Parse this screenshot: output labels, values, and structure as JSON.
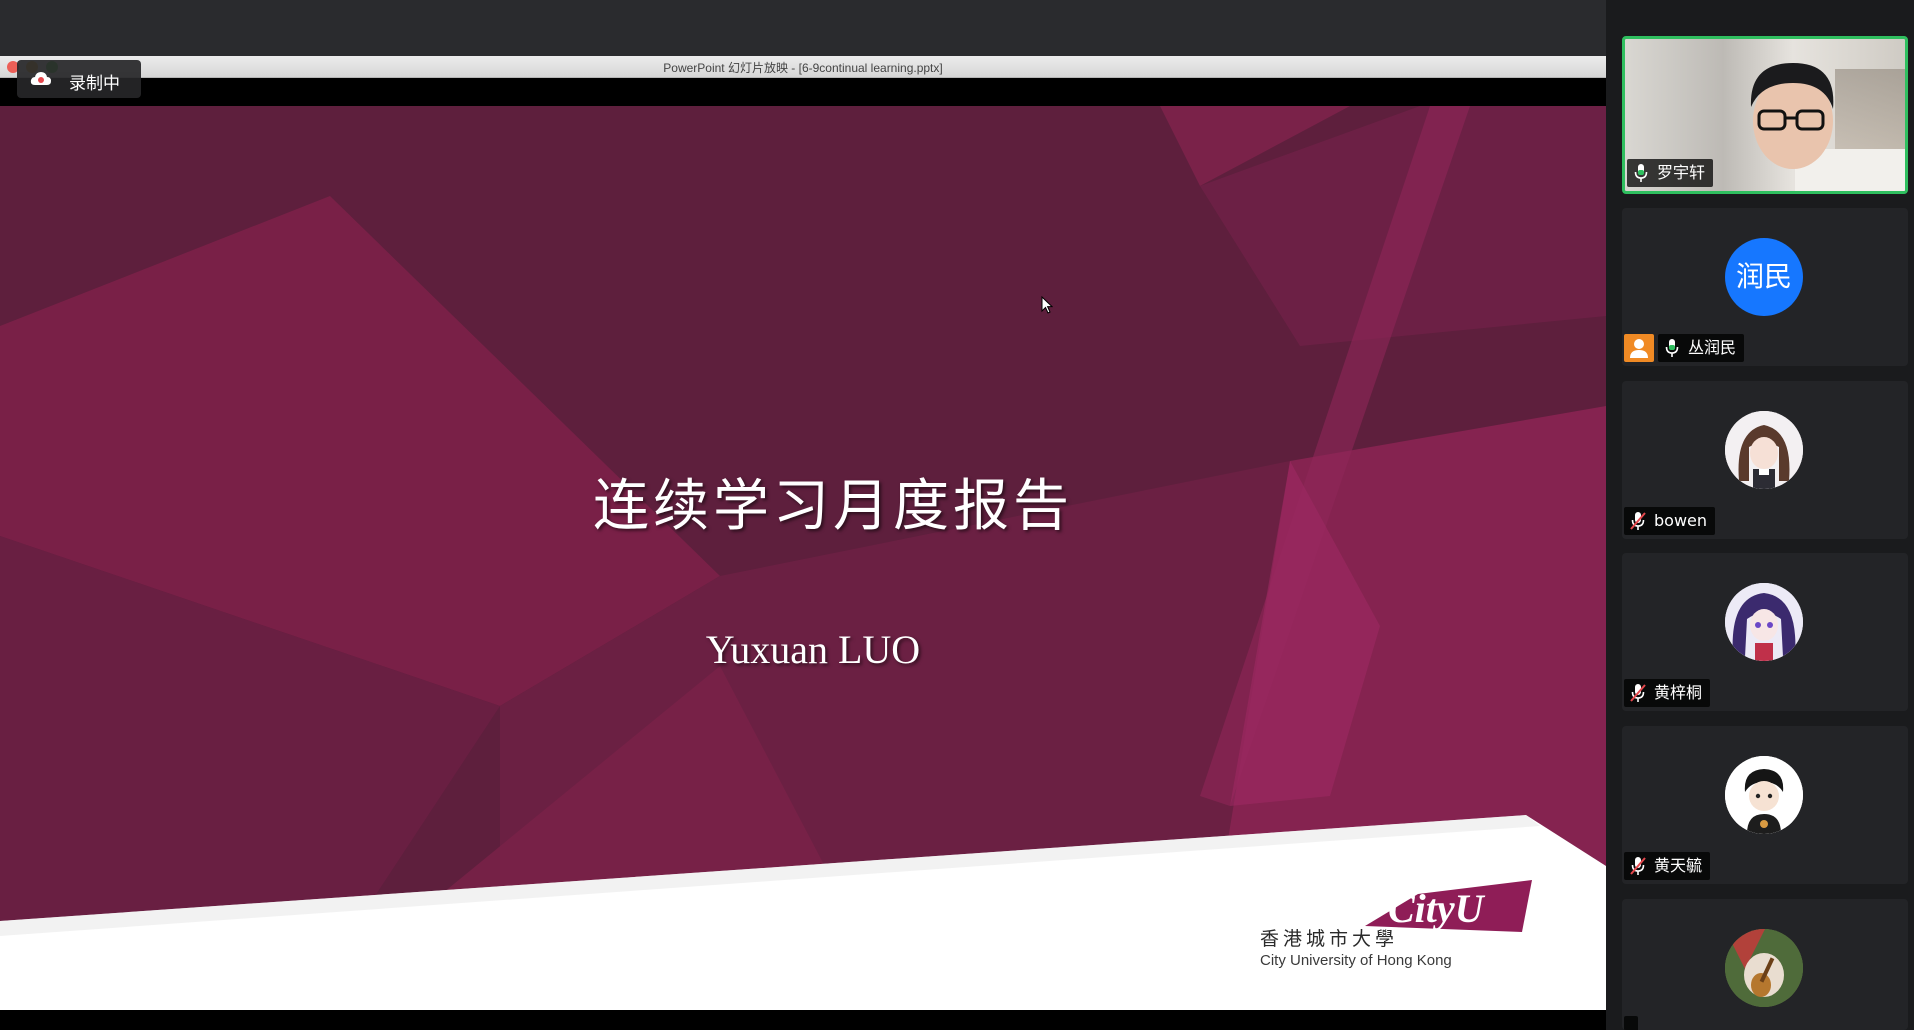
{
  "powerpoint": {
    "window_title": "PowerPoint 幻灯片放映 - [6-9continual learning.pptx]"
  },
  "recording": {
    "label": "录制中"
  },
  "slide": {
    "title": "连续学习月度报告",
    "author": "Yuxuan LUO",
    "logo": {
      "brand": "CityU",
      "name_cn": "香港城市大學",
      "name_en": "City University of Hong Kong"
    }
  },
  "participants": [
    {
      "name": "罗宇轩",
      "mic": "on",
      "video": true,
      "speaking": true
    },
    {
      "name": "丛润民",
      "mic": "on",
      "avatar_text": "润民",
      "avatar_color": "#1677ff",
      "host_icon": "person-icon"
    },
    {
      "name": "bowen",
      "mic": "muted",
      "avatar": "anime-girl-avatar"
    },
    {
      "name": "黄梓桐",
      "mic": "muted",
      "avatar": "anime-purple-hair-avatar"
    },
    {
      "name": "黄天毓",
      "mic": "muted",
      "avatar": "cartoon-boy-avatar"
    },
    {
      "name": "",
      "mic": "",
      "avatar": "guitar-avatar"
    }
  ],
  "colors": {
    "slide_bg": "#5e1f3d",
    "accent_magenta": "#8c2355",
    "active_border": "#2fbf5f",
    "mic_on": "#2fbf5f",
    "mic_muted": "#e5484d"
  }
}
